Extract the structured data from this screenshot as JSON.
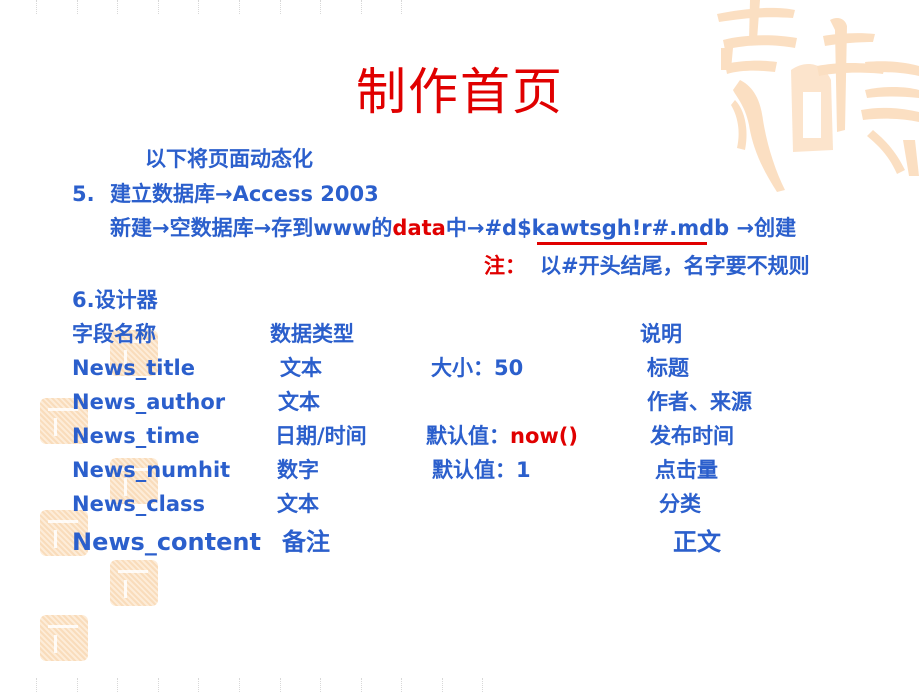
{
  "slide": {
    "title": "制作首页",
    "intro": "以下将页面动态化",
    "step5": {
      "number": "5.",
      "text": "建立数据库→Access 2003",
      "line2_part1": "新建→空数据库→存到www的",
      "line2_highlight": "data",
      "line2_part2": "中→",
      "filename": "#d$kawtsgh!r#.mdb",
      "line2_part3": " →创建"
    },
    "note": {
      "label": "注：",
      "text": "以#开头结尾，名字要不规则"
    },
    "step6": {
      "heading": "6.设计器"
    },
    "table": {
      "headers": {
        "field": "字段名称",
        "type": "数据类型",
        "desc": "说明"
      },
      "rows": [
        {
          "field": "News_title",
          "type": "文本",
          "extra": "大小：50",
          "extra_value_red": "",
          "desc": "标题"
        },
        {
          "field": "News_author",
          "type": "文本",
          "extra": "",
          "extra_value_red": "",
          "desc": "作者、来源"
        },
        {
          "field": "News_time",
          "type": "日期/时间",
          "extra": "默认值：",
          "extra_value_red": "now()",
          "desc": "发布时间"
        },
        {
          "field": "News_numhit",
          "type": "数字",
          "extra": "默认值：1",
          "extra_value_red": "",
          "desc": "点击量"
        },
        {
          "field": "News_class",
          "type": "文本",
          "extra": "",
          "extra_value_red": "",
          "desc": "分类"
        },
        {
          "field": "News_content",
          "type": "备注",
          "extra": "",
          "extra_value_red": "",
          "desc": "正文"
        }
      ]
    }
  },
  "decor": {
    "watermark": "calligraphy-seal-icon",
    "colors": {
      "text": "#2b5fcc",
      "accent": "#e00000",
      "seal": "#f9d7b0"
    }
  }
}
